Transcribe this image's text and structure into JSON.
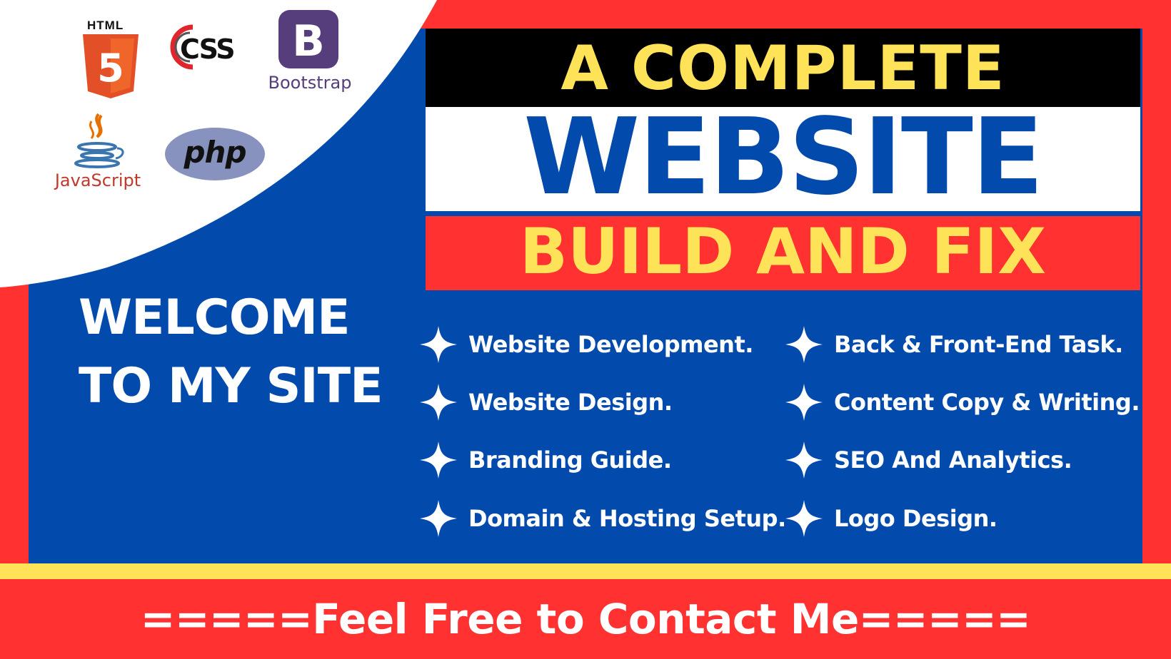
{
  "logos": {
    "html5_label": "HTML",
    "html5_number": "5",
    "css_label": "CSS",
    "bootstrap_letter": "B",
    "bootstrap_label": "Bootstrap",
    "javascript_label": "JavaScript",
    "php_label": "php"
  },
  "title": {
    "line1": "A COMPLETE",
    "line2": "WEBSITE",
    "line3": "BUILD AND FIX"
  },
  "welcome": {
    "line1": "WELCOME",
    "line2": "TO MY SITE"
  },
  "services": {
    "left": [
      "Website Development.",
      "Website Design.",
      "Branding Guide.",
      "Domain & Hosting Setup."
    ],
    "right": [
      "Back & Front-End Task.",
      "Content Copy & Writing.",
      "SEO And Analytics.",
      "Logo Design."
    ]
  },
  "footer": {
    "text": "=====Feel Free to Contact Me====="
  },
  "colors": {
    "red": "#ff3131",
    "blue": "#034aad",
    "yellow": "#fee257",
    "white": "#ffffff",
    "black": "#000000"
  },
  "icons": {
    "bullet": "four-point-star-icon"
  }
}
